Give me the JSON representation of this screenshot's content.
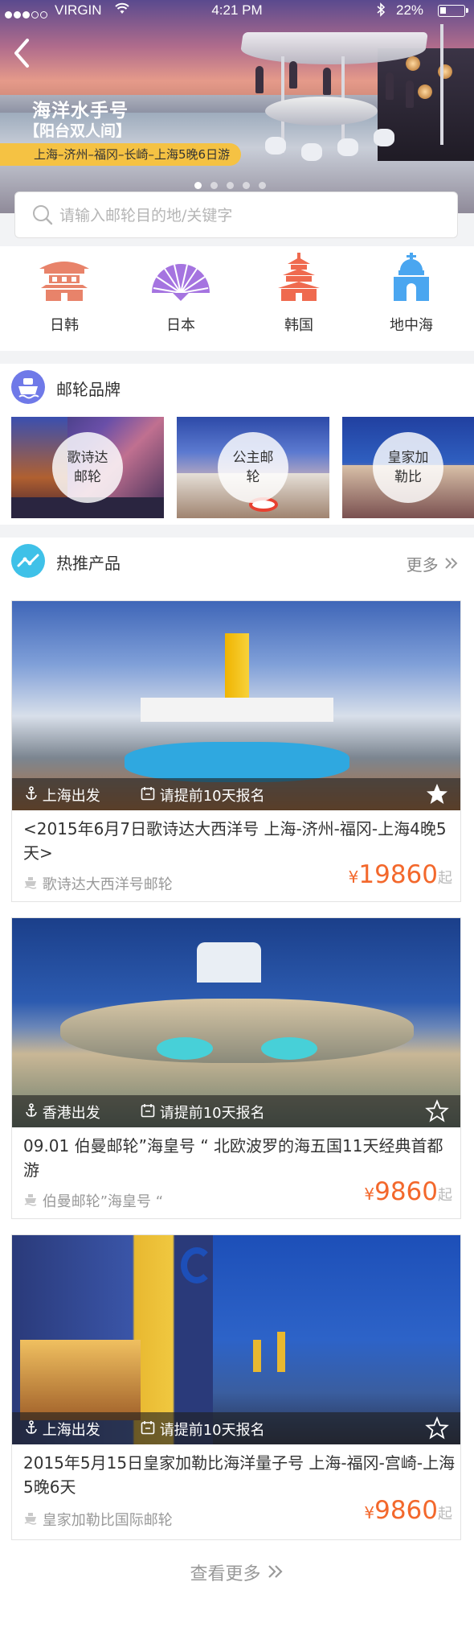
{
  "status_bar": {
    "carrier": "VIRGIN",
    "time": "4:21 PM",
    "battery": "22%"
  },
  "hero": {
    "title": "海洋水手号",
    "subtitle": "【阳台双人间】",
    "route": "上海–济州–福冈–长崎–上海5晚6日游",
    "page_count": 5,
    "active_page": 1
  },
  "search": {
    "placeholder": "请输入邮轮目的地/关键字"
  },
  "categories": [
    {
      "label": "日韩",
      "icon": "pagoda-icon",
      "color": "#e8836a"
    },
    {
      "label": "日本",
      "icon": "fan-icon",
      "color": "#a574e0"
    },
    {
      "label": "韩国",
      "icon": "tower-icon",
      "color": "#ef6a4f"
    },
    {
      "label": "地中海",
      "icon": "chapel-icon",
      "color": "#4aa6f0"
    }
  ],
  "brands": {
    "title": "邮轮品牌",
    "items": [
      {
        "label": "歌诗达邮轮"
      },
      {
        "label": "公主邮轮"
      },
      {
        "label": "皇家加勒比"
      }
    ]
  },
  "hot": {
    "title": "热推产品",
    "more": "更多",
    "see_more": "查看更多",
    "products": [
      {
        "departure": "上海出发",
        "register": "请提前10天报名",
        "title": "<2015年6月7日歌诗达大西洋号 上海-济州-福冈-上海4晚5天>",
        "line": "歌诗达大西洋号邮轮",
        "currency": "¥",
        "price": "19860",
        "suffix": "起",
        "favorited": true
      },
      {
        "departure": "香港出发",
        "register": "请提前10天报名",
        "title": "09.01 伯曼邮轮”海皇号 “ 北欧波罗的海五国11天经典首都游",
        "line": "伯曼邮轮”海皇号 “",
        "currency": "¥",
        "price": "9860",
        "suffix": "起",
        "favorited": false
      },
      {
        "departure": "上海出发",
        "register": "请提前10天报名",
        "title": "2015年5月15日皇家加勒比海洋量子号 上海-福冈-宫崎-上海5晚6天",
        "line": "皇家加勒比国际邮轮",
        "currency": "¥",
        "price": "9860",
        "suffix": "起",
        "favorited": false
      }
    ]
  }
}
